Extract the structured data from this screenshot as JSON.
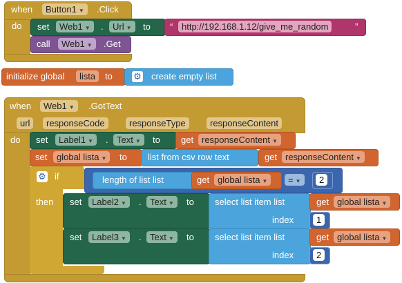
{
  "colors": {
    "event": "#C39B32",
    "component": "#236649",
    "variable": "#D06530",
    "list": "#4BA4DB",
    "text": "#B0356A",
    "procedure": "#7E5592",
    "math": "#3A66AE"
  },
  "block1": {
    "when": "when",
    "component": "Button1",
    "event": ".Click",
    "do": "do",
    "set": "set",
    "set_component": "Web1",
    "dot": ".",
    "set_property": "Url",
    "to": "to",
    "url_value": "http://192.168.1.12/give_me_random",
    "quote_open": "“",
    "quote_close": "”",
    "call": "call",
    "call_component": "Web1",
    "call_method": ".Get"
  },
  "block2": {
    "label": "initialize global",
    "name": "lista",
    "to": "to",
    "value": "create empty list"
  },
  "block3": {
    "when": "when",
    "component": "Web1",
    "event": ".GotText",
    "params": [
      "url",
      "responseCode",
      "responseType",
      "responseContent"
    ],
    "do": "do",
    "set": "set",
    "set1_component": "Label1",
    "set1_property": "Text",
    "dot": ".",
    "to": "to",
    "get": "get",
    "response_content": "responseContent",
    "set2_label": "set",
    "global_lista": "global lista",
    "list_from_csv": "list from csv row  text",
    "if": "if",
    "length_of_list": "length of list  list",
    "eq": "=",
    "num_2": "2",
    "then": "then",
    "label2": "Label2",
    "label3": "Label3",
    "text_prop": "Text",
    "select_item": "select list item  list",
    "index": "index",
    "idx1": "1",
    "idx2": "2"
  }
}
